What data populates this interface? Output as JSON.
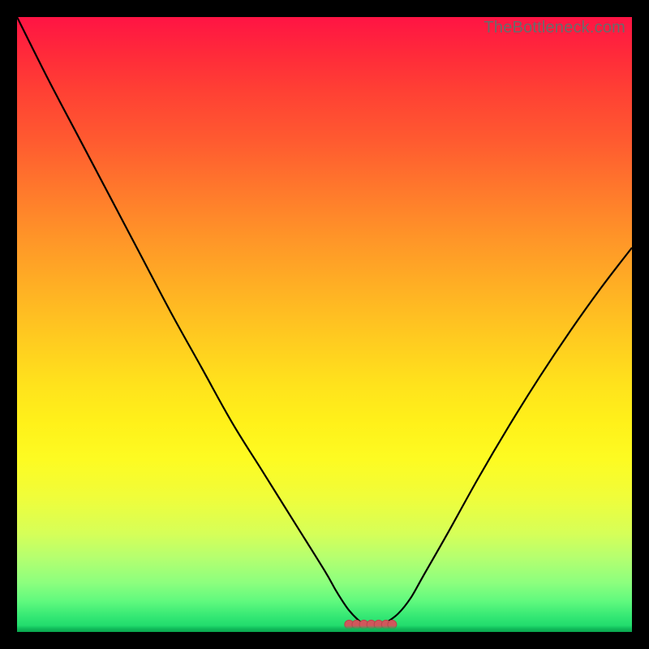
{
  "watermark": "TheBottleneck.com",
  "colors": {
    "curve_stroke": "#000000",
    "marker_fill": "#d1575c",
    "marker_stroke": "#b8474c"
  },
  "chart_data": {
    "type": "line",
    "title": "",
    "xlabel": "",
    "ylabel": "",
    "xlim": [
      0,
      100
    ],
    "ylim": [
      0,
      100
    ],
    "x": [
      0,
      5,
      10,
      15,
      20,
      25,
      30,
      35,
      40,
      45,
      50,
      52,
      54,
      56,
      57,
      58,
      59,
      60,
      62,
      64,
      66,
      70,
      75,
      80,
      85,
      90,
      95,
      100
    ],
    "values": [
      100,
      90,
      80.5,
      71,
      61.5,
      52,
      43,
      34,
      26,
      18,
      10,
      6.5,
      3.5,
      1.5,
      1,
      1,
      1,
      1.5,
      3,
      5.5,
      9,
      16,
      25,
      33.5,
      41.5,
      49,
      56,
      62.5
    ],
    "flat_segment": {
      "x_start": 54,
      "x_end": 61,
      "y": 1.2,
      "markers_x": [
        54,
        55.2,
        56.4,
        57.6,
        58.8,
        60,
        61
      ]
    }
  }
}
